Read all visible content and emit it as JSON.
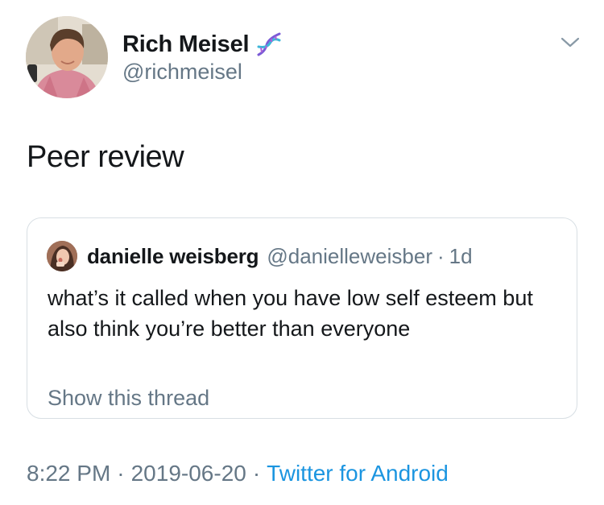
{
  "tweet": {
    "author": {
      "name": "Rich Meisel",
      "handle": "@richmeisel",
      "badge_icon": "dna-icon"
    },
    "text": "Peer review",
    "menu_icon": "chevron-down-icon"
  },
  "quoted_tweet": {
    "author": {
      "name": "danielle weisberg",
      "handle": "@danielleweisber"
    },
    "separator": "·",
    "time": "1d",
    "text": "what’s it called when you have low self esteem but also think you’re better than everyone",
    "show_thread_label": "Show this thread"
  },
  "meta": {
    "time": "8:22 PM",
    "date": "2019-06-20",
    "separator": "·",
    "source": "Twitter for Android"
  },
  "colors": {
    "text_primary": "#14171a",
    "text_secondary": "#657786",
    "link": "#1b95e0",
    "border": "#d8dfe4"
  }
}
